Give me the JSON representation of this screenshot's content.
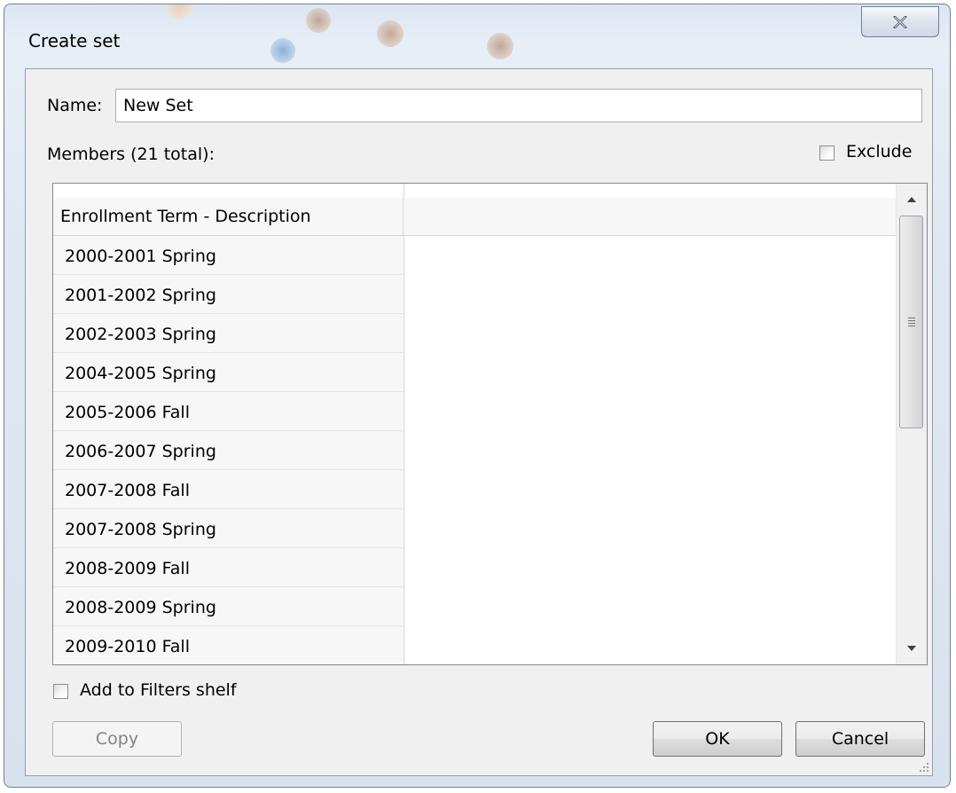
{
  "window": {
    "title": "Create set",
    "close_icon": "close-x-icon"
  },
  "form": {
    "name_label": "Name:",
    "name_value": "New Set",
    "members_label": "Members (21 total):",
    "exclude_label": "Exclude",
    "exclude_checked": false
  },
  "grid": {
    "column_header": "Enrollment Term - Description",
    "rows": [
      "2000-2001 Spring",
      "2001-2002 Spring",
      "2002-2003 Spring",
      "2004-2005 Spring",
      "2005-2006 Fall",
      "2006-2007 Spring",
      "2007-2008 Fall",
      "2007-2008 Spring",
      "2008-2009 Fall",
      "2008-2009 Spring",
      "2009-2010 Fall"
    ]
  },
  "footer": {
    "add_to_filters_label": "Add to Filters shelf",
    "add_to_filters_checked": false,
    "copy_label": "Copy",
    "ok_label": "OK",
    "cancel_label": "Cancel"
  }
}
